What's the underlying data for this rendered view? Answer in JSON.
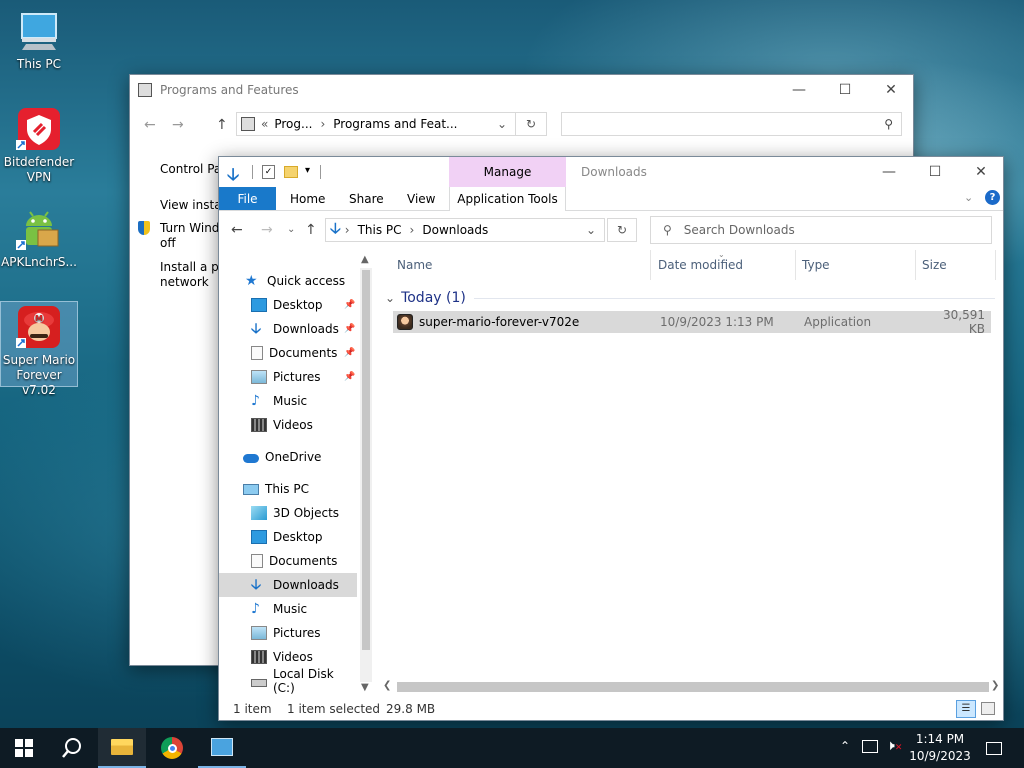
{
  "desktop": {
    "icons": [
      {
        "label": "This PC",
        "icon": "this-pc-icon"
      },
      {
        "label": "Bitdefender VPN",
        "icon": "bitdefender-vpn-icon"
      },
      {
        "label": "APKLnchrS...",
        "icon": "android-apk-launcher-icon"
      },
      {
        "label": "Super Mario Forever v7.02",
        "icon": "super-mario-icon"
      }
    ]
  },
  "programs_window": {
    "title": "Programs and Features",
    "breadcrumb": [
      "Prog...",
      "Programs and Feat..."
    ],
    "breadcrumb_prefix": "«",
    "sidebar": {
      "control_panel": "Control Par",
      "view_installed": "View install",
      "turn_windows": "Turn Windo",
      "turn_windows_2": "off",
      "install_program": "Install a pro",
      "install_program_2": "network"
    }
  },
  "explorer": {
    "title": "Downloads",
    "ribbon": {
      "context_group": "Manage",
      "tabs": [
        "File",
        "Home",
        "Share",
        "View",
        "Application Tools"
      ]
    },
    "address": {
      "path": [
        "This PC",
        "Downloads"
      ]
    },
    "search": {
      "placeholder": "Search Downloads"
    },
    "nav": {
      "quick_access": "Quick access",
      "quick_items": [
        "Desktop",
        "Downloads",
        "Documents",
        "Pictures",
        "Music",
        "Videos"
      ],
      "onedrive": "OneDrive",
      "this_pc": "This PC",
      "pc_items": [
        "3D Objects",
        "Desktop",
        "Documents",
        "Downloads",
        "Music",
        "Pictures",
        "Videos",
        "Local Disk (C:)"
      ]
    },
    "columns": [
      "Name",
      "Date modified",
      "Type",
      "Size"
    ],
    "group": {
      "label": "Today (1)"
    },
    "files": [
      {
        "name": "super-mario-forever-v702e",
        "date": "10/9/2023 1:13 PM",
        "type": "Application",
        "size": "30,591 KB"
      }
    ],
    "status": {
      "count": "1 item",
      "selected": "1 item selected",
      "size": "29.8 MB"
    }
  },
  "taskbar": {
    "time": "1:14 PM",
    "date": "10/9/2023"
  },
  "colors": {
    "accent": "#0063b1",
    "manage_tab": "#f1d1f5",
    "selection": "#cce8ff"
  }
}
